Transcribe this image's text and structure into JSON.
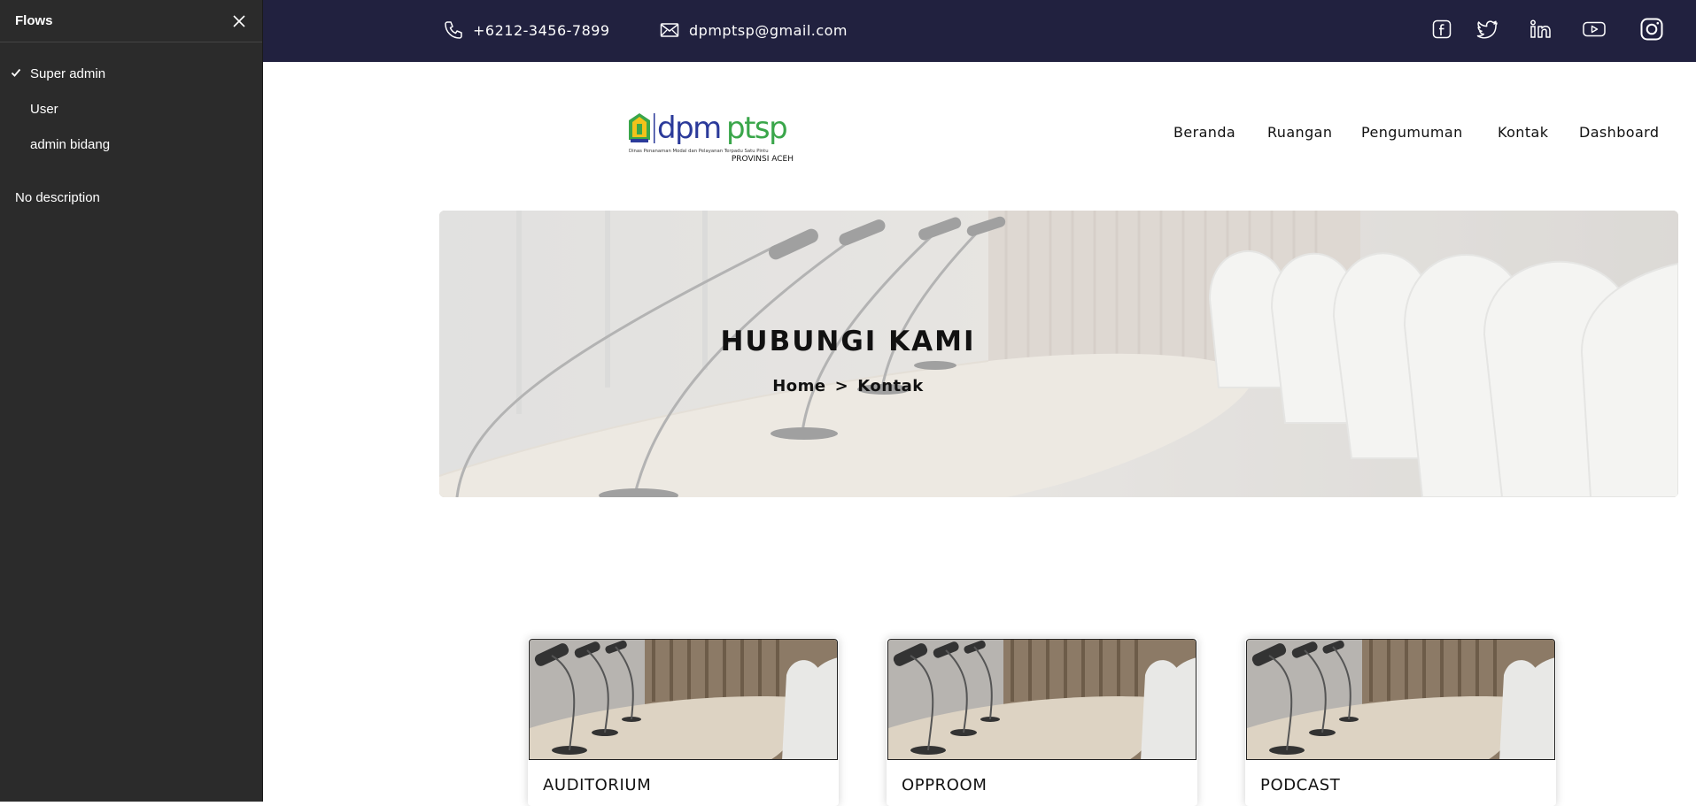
{
  "flows_panel": {
    "title": "Flows",
    "items": [
      {
        "label": "Super admin",
        "selected": true
      },
      {
        "label": "User",
        "selected": false
      },
      {
        "label": "admin bidang",
        "selected": false
      }
    ],
    "description": "No description"
  },
  "topbar": {
    "phone": "+6212-3456-7899",
    "email": "dpmptsp@gmail.com",
    "socials": [
      "facebook-icon",
      "twitter-icon",
      "linkedin-icon",
      "youtube-icon",
      "instagram-icon"
    ],
    "background": "#21213f"
  },
  "logo": {
    "brand": "dpmptsp",
    "tagline": "Dinas Penanaman Modal dan Pelayanan Terpadu Satu Pintu",
    "region": "PROVINSI ACEH"
  },
  "nav": {
    "items": [
      "Beranda",
      "Ruangan",
      "Pengumuman",
      "Kontak",
      "Dashboard"
    ]
  },
  "banner": {
    "title": "HUBUNGI KAMI",
    "breadcrumb_home": "Home",
    "breadcrumb_sep": ">",
    "breadcrumb_current": "Kontak"
  },
  "rooms": [
    {
      "name": "AUDITORIUM"
    },
    {
      "name": "OPPROOM"
    },
    {
      "name": "PODCAST"
    }
  ],
  "colors": {
    "panel_bg": "#2b2b2b",
    "topbar_bg": "#21213f",
    "logo_blue": "#2b3a9a",
    "logo_green": "#3aa64a"
  }
}
